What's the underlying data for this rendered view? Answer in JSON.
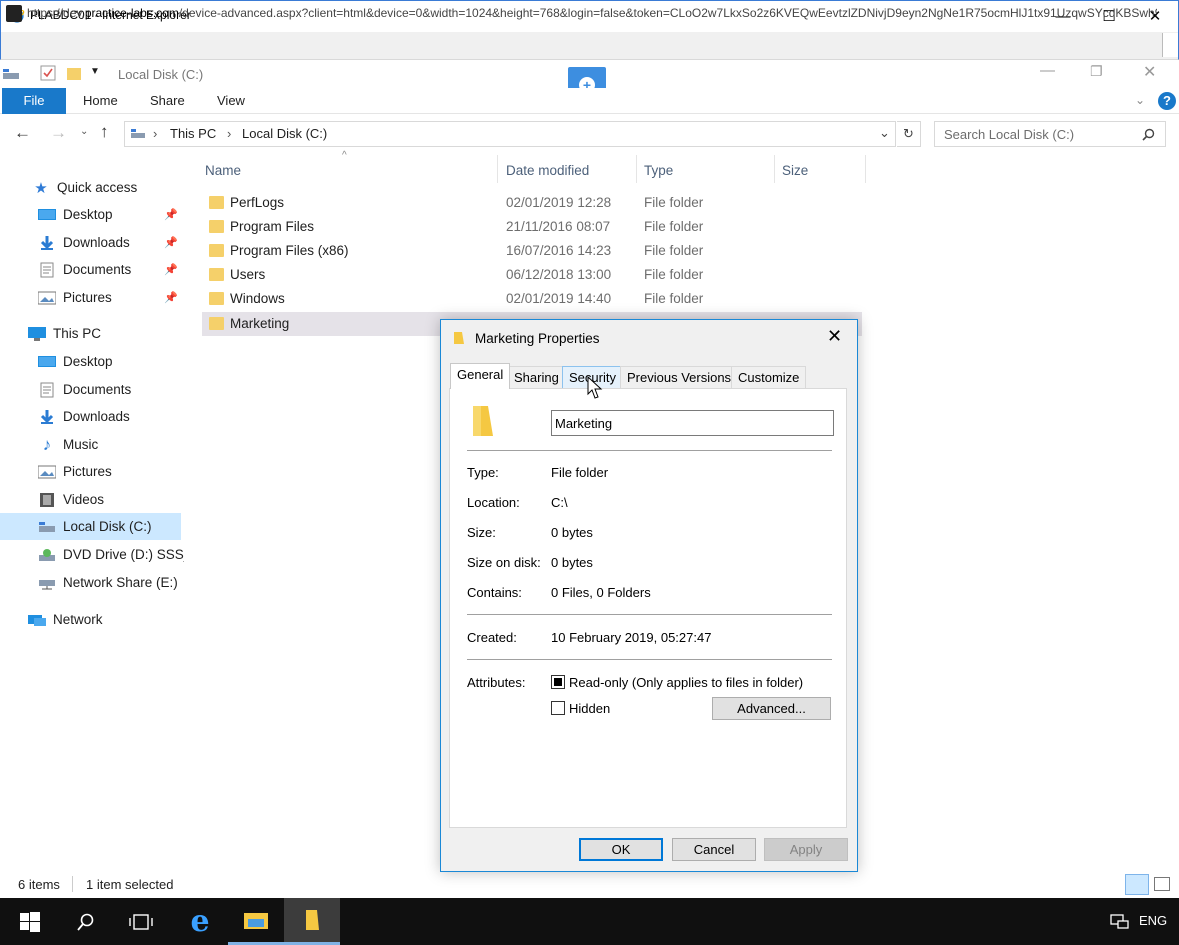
{
  "browser": {
    "title": "PLABDC01 - Internet Explorer",
    "url_prefix": "https://dev.",
    "url_domain": "practice-labs.com",
    "url_rest": "/device-advanced.aspx?client=html&device=0&width=1024&height=768&login=false&token=CLoO2w7LkxSo2z6KVEQwEevtzlZDNivjD9eyn2NgNe1R75ocmHlJ1tx91UzqwSYcdKBSwh95",
    "minimize_glyph": "—",
    "maximize_glyph": "☐",
    "close_glyph": "✕"
  },
  "explorer": {
    "qat_title": "Local Disk (C:)",
    "ribbon_tabs": [
      "File",
      "Home",
      "Share",
      "View"
    ],
    "breadcrumb": [
      "This PC",
      "Local Disk (C:)"
    ],
    "search_placeholder": "Search Local Disk (C:)",
    "columns": [
      "Name",
      "Date modified",
      "Type",
      "Size"
    ],
    "files": [
      {
        "name": "PerfLogs",
        "date": "02/01/2019 12:28",
        "type": "File folder"
      },
      {
        "name": "Program Files",
        "date": "21/11/2016 08:07",
        "type": "File folder"
      },
      {
        "name": "Program Files (x86)",
        "date": "16/07/2016 14:23",
        "type": "File folder"
      },
      {
        "name": "Users",
        "date": "06/12/2018 13:00",
        "type": "File folder"
      },
      {
        "name": "Windows",
        "date": "02/01/2019 14:40",
        "type": "File folder"
      },
      {
        "name": "Marketing",
        "date": "",
        "type": ""
      }
    ],
    "sidebar": {
      "quick_access": "Quick access",
      "quick_items": [
        "Desktop",
        "Downloads",
        "Documents",
        "Pictures"
      ],
      "this_pc": "This PC",
      "pc_items": [
        "Desktop",
        "Documents",
        "Downloads",
        "Music",
        "Pictures",
        "Videos",
        "Local Disk (C:)",
        "DVD Drive (D:) SSS_X",
        "Network Share (E:)"
      ],
      "network": "Network"
    },
    "status": {
      "items": "6 items",
      "selected": "1 item selected"
    }
  },
  "dialog": {
    "title": "Marketing Properties",
    "tabs": [
      "General",
      "Sharing",
      "Security",
      "Previous Versions",
      "Customize"
    ],
    "name_value": "Marketing",
    "fields": {
      "type_label": "Type:",
      "type_value": "File folder",
      "location_label": "Location:",
      "location_value": "C:\\",
      "size_label": "Size:",
      "size_value": "0 bytes",
      "size_on_disk_label": "Size on disk:",
      "size_on_disk_value": "0 bytes",
      "contains_label": "Contains:",
      "contains_value": "0 Files, 0 Folders",
      "created_label": "Created:",
      "created_value": "10 February 2019, 05:27:47",
      "attributes_label": "Attributes:"
    },
    "readonly_label": "Read-only (Only applies to files in folder)",
    "hidden_label": "Hidden",
    "advanced_label": "Advanced...",
    "ok_label": "OK",
    "cancel_label": "Cancel",
    "apply_label": "Apply"
  },
  "taskbar": {
    "lang": "ENG"
  },
  "colors": {
    "accent": "#1979ca",
    "dialog_border": "#1a88d6",
    "folder": "#f5d06a",
    "taskbar": "#101010"
  }
}
